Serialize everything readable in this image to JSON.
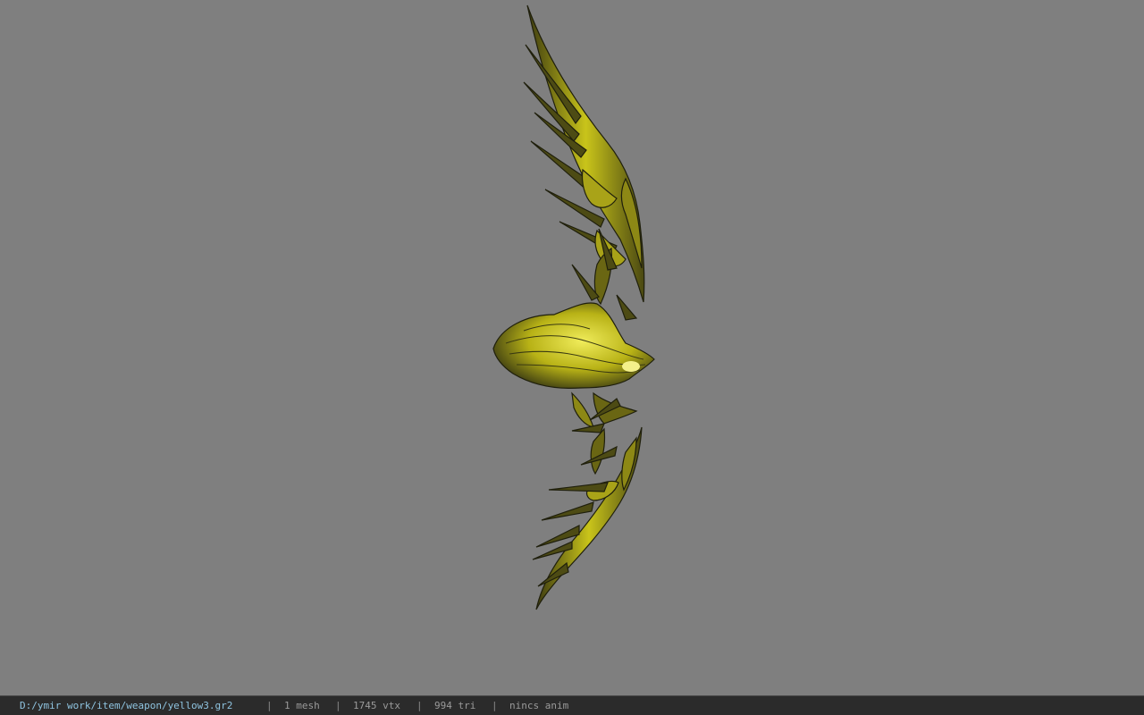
{
  "viewport": {
    "background": "#7f7f7f",
    "model": {
      "icon": "ornate-yellow-bow-model",
      "colors": {
        "body": "#c9c41a",
        "highlight": "#f0ec5a",
        "shadow": "#3a3a12",
        "outline": "#1f1f0c"
      }
    }
  },
  "statusbar": {
    "file_path": "D:/ymir work/item/weapon/yellow3.gr2",
    "separator": "|",
    "mesh_count": "1 mesh",
    "vertex_count": "1745 vtx",
    "triangle_count": "994 tri",
    "anim_status": "nincs anim"
  }
}
